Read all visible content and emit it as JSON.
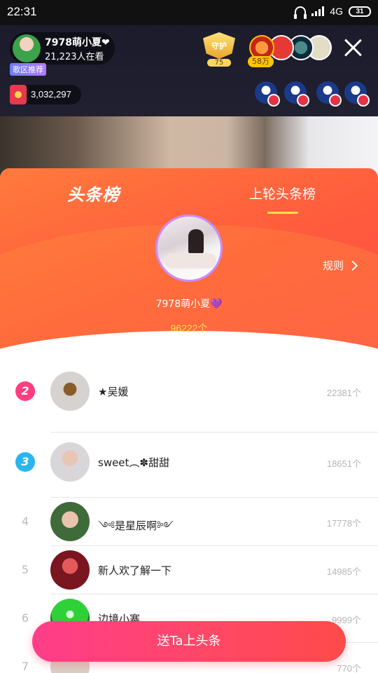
{
  "status_bar": {
    "time": "22:31",
    "network": "4G",
    "battery": "31"
  },
  "live": {
    "host_name": "7978萌小夏❤",
    "viewers": "21,223人在看",
    "host_tag": "歌区推荐",
    "guard_label": "守护",
    "guard_count": "75",
    "fan_money": "58万",
    "coins": "3,032,297"
  },
  "panel": {
    "tab_headline": "头条榜",
    "tab_last_round": "上轮头条榜",
    "rules_label": "规则",
    "winner": {
      "name": "7978萌小夏💜",
      "count": "96222个"
    },
    "ranking": [
      {
        "rank": "2",
        "name": "★吴媛",
        "count": "22381个"
      },
      {
        "rank": "3",
        "name": "sweet︵✽甜甜",
        "count": "18651个"
      },
      {
        "rank": "4",
        "name": "༺是星辰啊༻",
        "count": "17778个"
      },
      {
        "rank": "5",
        "name": "新人欢了解一下",
        "count": "14985个"
      },
      {
        "rank": "6",
        "name": "边境小寨",
        "count": "9999个"
      },
      {
        "rank": "7",
        "name": "",
        "count": "770个"
      }
    ]
  },
  "action": {
    "send_label": "送Ta上头条"
  },
  "colors": {
    "accent": "#ff5a3d",
    "highlight": "#ffe14a",
    "rank2": "#ff3d7f",
    "rank3": "#2bb5f0"
  }
}
